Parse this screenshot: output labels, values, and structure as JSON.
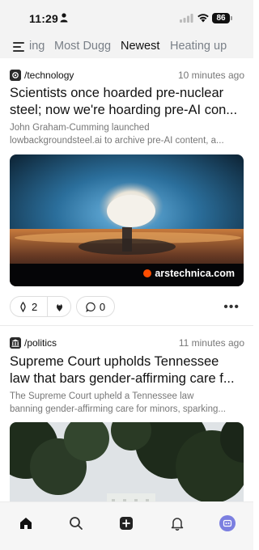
{
  "status_bar": {
    "time": "11:29",
    "battery": "86"
  },
  "tabs": [
    {
      "label": "ing",
      "active": false
    },
    {
      "label": "Most Dugg",
      "active": false
    },
    {
      "label": "Newest",
      "active": true
    },
    {
      "label": "Heating up",
      "active": false
    }
  ],
  "posts": [
    {
      "community": "/technology",
      "time_ago": "10 minutes ago",
      "title_lines": [
        "Scientists once hoarded pre-nuclear",
        "steel; now we're hoarding pre-AI con..."
      ],
      "excerpt_lines": [
        "John Graham-Cumming launched",
        "lowbackgroundsteel.ai to archive pre-AI content, a..."
      ],
      "image_source": "arstechnica.com",
      "upvotes": "2",
      "comments": "0"
    },
    {
      "community": "/politics",
      "time_ago": "11 minutes ago",
      "title_lines": [
        "Supreme Court upholds Tennessee",
        "law that bars gender-affirming care f..."
      ],
      "excerpt_lines": [
        "The Supreme Court upheld a Tennessee law",
        "banning gender-affirming care for minors, sparking..."
      ]
    }
  ],
  "bottom_nav": {
    "items": [
      "home-icon",
      "search-icon",
      "add-post-icon",
      "notifications-icon",
      "profile-avatar"
    ]
  },
  "colors": {
    "accent": "#7b7fe0",
    "source_dot": "#ff4e00",
    "muted_text": "#777777"
  }
}
